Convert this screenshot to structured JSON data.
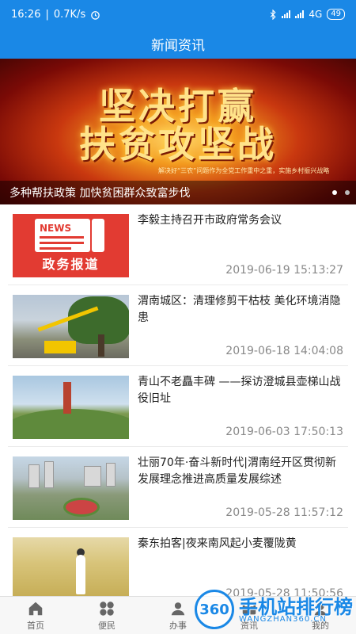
{
  "status_bar": {
    "time": "16:26",
    "speed": "0.7K/s",
    "network": "4G",
    "battery": "49"
  },
  "header": {
    "title": "新闻资讯"
  },
  "banner": {
    "headline_line1": "坚决打赢",
    "headline_line2": "扶贫攻坚战",
    "slogan_small": "解决好“三农”问题作为全党工作重中之重，实施乡村振兴战略",
    "caption": "多种帮扶政策 加快贫困群众致富步伐",
    "dots": 2,
    "active_dot": 0
  },
  "news": [
    {
      "title": "李毅主持召开市政府常务会议",
      "date": "2019-06-19 15:13:27",
      "thumb": "news-report",
      "thumb_head": "NEWS",
      "thumb_label": "政务报道"
    },
    {
      "title": "渭南城区：清理修剪干枯枝 美化环境消隐患",
      "date": "2019-06-18 14:04:08",
      "thumb": "tree-trimming"
    },
    {
      "title": "青山不老矗丰碑 ——探访澄城县壶梯山战役旧址",
      "date": "2019-06-03 17:50:13",
      "thumb": "monument-hill"
    },
    {
      "title": "壮丽70年·奋斗新时代|渭南经开区贯彻新发展理念推进高质量发展综述",
      "date": "2019-05-28 11:57:12",
      "thumb": "city-aerial"
    },
    {
      "title": "秦东拍客|夜来南风起小麦覆陇黄",
      "date": "2019-05-28 11:50:56",
      "thumb": "wheat-field"
    }
  ],
  "tabs": [
    {
      "label": "首页",
      "icon": "home-icon"
    },
    {
      "label": "便民",
      "icon": "grid-icon"
    },
    {
      "label": "办事",
      "icon": "person-icon"
    },
    {
      "label": "资讯",
      "icon": "news-icon"
    },
    {
      "label": "我的",
      "icon": "user-icon"
    }
  ],
  "watermark": {
    "logo": "360",
    "text": "手机站排行榜",
    "sub": "WANGZHAN360.CN"
  },
  "colors": {
    "accent": "#1a88e6"
  }
}
